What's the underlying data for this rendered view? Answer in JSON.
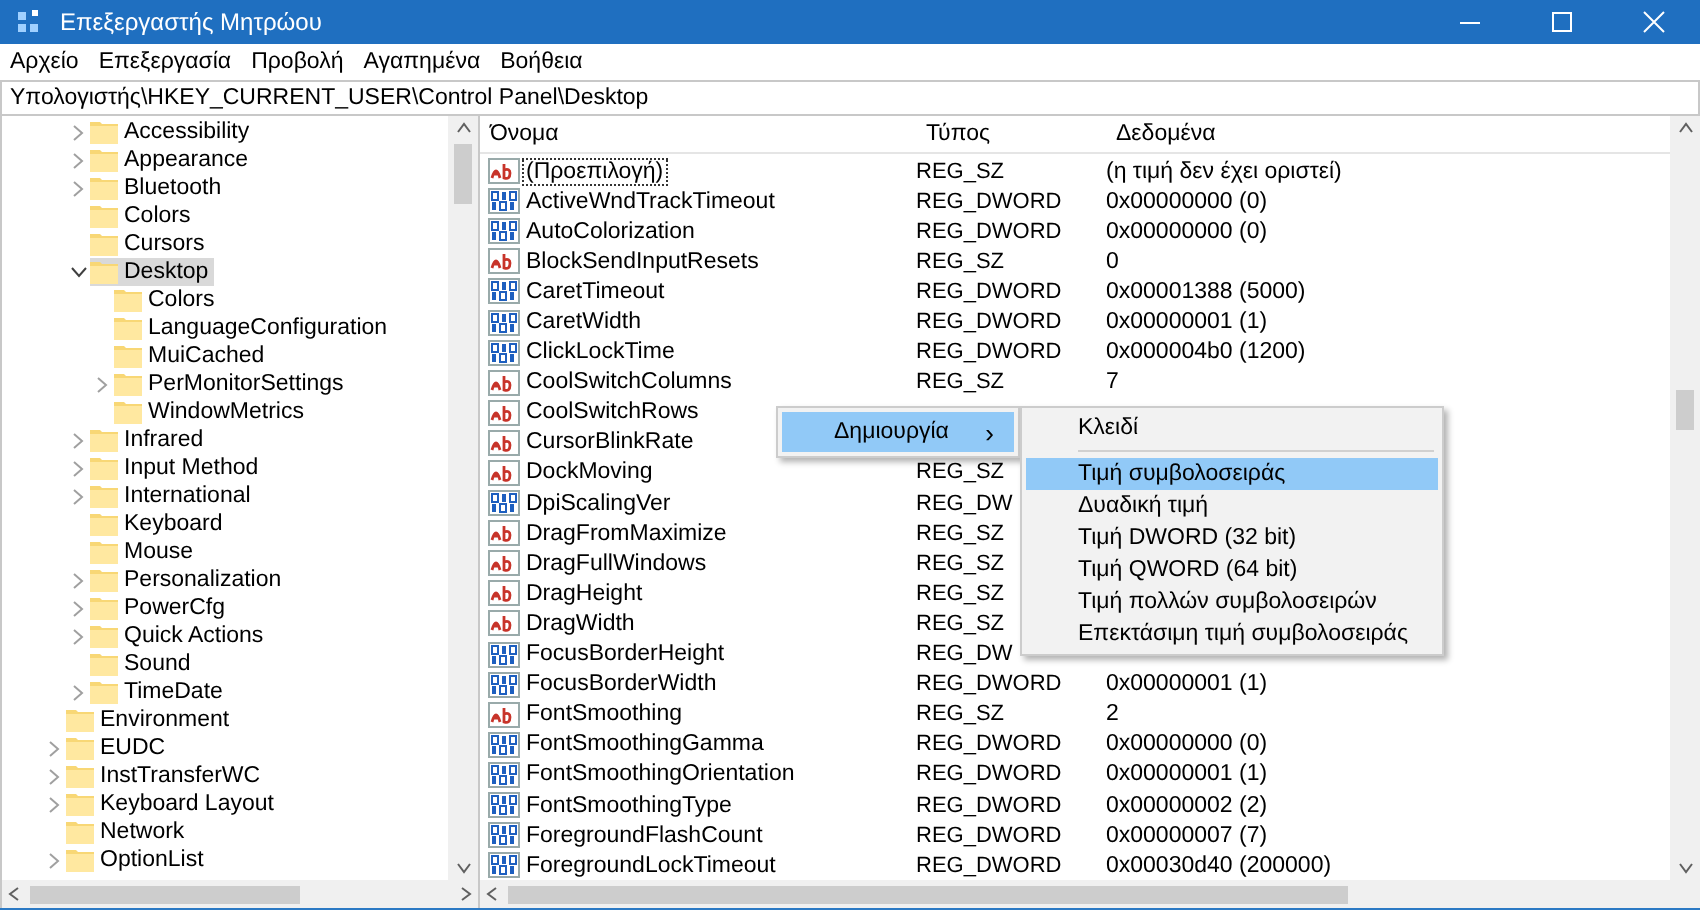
{
  "window": {
    "title": "Επεξεργαστής Μητρώου"
  },
  "menu_bar": [
    "Αρχείο",
    "Επεξεργασία",
    "Προβολή",
    "Αγαπημένα",
    "Βοήθεια"
  ],
  "address": "Υπολογιστής\\HKEY_CURRENT_USER\\Control Panel\\Desktop",
  "tree": {
    "nested_items": [
      {
        "label": "Accessibility",
        "expandable": true,
        "expanded": false,
        "selected": false
      },
      {
        "label": "Appearance",
        "expandable": true,
        "expanded": false,
        "selected": false
      },
      {
        "label": "Bluetooth",
        "expandable": true,
        "expanded": false,
        "selected": false
      },
      {
        "label": "Colors",
        "expandable": false,
        "selected": false
      },
      {
        "label": "Cursors",
        "expandable": false,
        "selected": false
      },
      {
        "label": "Desktop",
        "expandable": true,
        "expanded": true,
        "selected": true,
        "children": [
          {
            "label": "Colors",
            "expandable": false,
            "selected": false
          },
          {
            "label": "LanguageConfiguration",
            "expandable": false,
            "selected": false
          },
          {
            "label": "MuiCached",
            "expandable": false,
            "selected": false
          },
          {
            "label": "PerMonitorSettings",
            "expandable": true,
            "expanded": false,
            "selected": false
          },
          {
            "label": "WindowMetrics",
            "expandable": false,
            "selected": false
          }
        ]
      },
      {
        "label": "Infrared",
        "expandable": true,
        "expanded": false,
        "selected": false
      },
      {
        "label": "Input Method",
        "expandable": true,
        "expanded": false,
        "selected": false
      },
      {
        "label": "International",
        "expandable": true,
        "expanded": false,
        "selected": false
      },
      {
        "label": "Keyboard",
        "expandable": false,
        "selected": false
      },
      {
        "label": "Mouse",
        "expandable": false,
        "selected": false
      },
      {
        "label": "Personalization",
        "expandable": true,
        "expanded": false,
        "selected": false
      },
      {
        "label": "PowerCfg",
        "expandable": true,
        "expanded": false,
        "selected": false
      },
      {
        "label": "Quick Actions",
        "expandable": true,
        "expanded": false,
        "selected": false
      },
      {
        "label": "Sound",
        "expandable": false,
        "selected": false
      },
      {
        "label": "TimeDate",
        "expandable": true,
        "expanded": false,
        "selected": false
      }
    ],
    "items": [
      {
        "label": "Environment",
        "expandable": false,
        "selected": false
      },
      {
        "label": "EUDC",
        "expandable": true,
        "expanded": false,
        "selected": false
      },
      {
        "label": "InstTransferWC",
        "expandable": true,
        "expanded": false,
        "selected": false
      },
      {
        "label": "Keyboard Layout",
        "expandable": true,
        "expanded": false,
        "selected": false
      },
      {
        "label": "Network",
        "expandable": false,
        "selected": false
      },
      {
        "label": "OptionList",
        "expandable": true,
        "expanded": false,
        "selected": false
      }
    ]
  },
  "values": {
    "columns": [
      "Όνομα",
      "Τύπος",
      "Δεδομένα"
    ],
    "rows": [
      {
        "kind": "sz",
        "name": "(Προεπιλογή)",
        "focused": true,
        "type": "REG_SZ",
        "data": "(η τιμή δεν έχει οριστεί)"
      },
      {
        "kind": "dword",
        "name": "ActiveWndTrackTimeout",
        "focused": false,
        "type": "REG_DWORD",
        "data": "0x00000000 (0)"
      },
      {
        "kind": "dword",
        "name": "AutoColorization",
        "focused": false,
        "type": "REG_DWORD",
        "data": "0x00000000 (0)"
      },
      {
        "kind": "sz",
        "name": "BlockSendInputResets",
        "focused": false,
        "type": "REG_SZ",
        "data": "0"
      },
      {
        "kind": "dword",
        "name": "CaretTimeout",
        "focused": false,
        "type": "REG_DWORD",
        "data": "0x00001388 (5000)"
      },
      {
        "kind": "dword",
        "name": "CaretWidth",
        "focused": false,
        "type": "REG_DWORD",
        "data": "0x00000001 (1)"
      },
      {
        "kind": "dword",
        "name": "ClickLockTime",
        "focused": false,
        "type": "REG_DWORD",
        "data": "0x000004b0 (1200)"
      },
      {
        "kind": "sz",
        "name": "CoolSwitchColumns",
        "focused": false,
        "type": "REG_SZ",
        "data": "7"
      },
      {
        "kind": "sz",
        "name": "CoolSwitchRows",
        "focused": false
      },
      {
        "kind": "sz",
        "name": "CursorBlinkRate",
        "focused": false
      },
      {
        "kind": "sz",
        "name": "DockMoving",
        "focused": false,
        "type": "REG_SZ"
      },
      {
        "kind": "dword",
        "name": "DpiScalingVer",
        "focused": false,
        "type": "REG_DW"
      },
      {
        "kind": "sz",
        "name": "DragFromMaximize",
        "focused": false,
        "type": "REG_SZ"
      },
      {
        "kind": "sz",
        "name": "DragFullWindows",
        "focused": false,
        "type": "REG_SZ"
      },
      {
        "kind": "sz",
        "name": "DragHeight",
        "focused": false,
        "type": "REG_SZ"
      },
      {
        "kind": "sz",
        "name": "DragWidth",
        "focused": false,
        "type": "REG_SZ"
      },
      {
        "kind": "dword",
        "name": "FocusBorderHeight",
        "focused": false,
        "type": "REG_DW"
      },
      {
        "kind": "dword",
        "name": "FocusBorderWidth",
        "focused": false,
        "type": "REG_DWORD",
        "data": "0x00000001 (1)"
      },
      {
        "kind": "sz",
        "name": "FontSmoothing",
        "focused": false,
        "type": "REG_SZ",
        "data": "2"
      },
      {
        "kind": "dword",
        "name": "FontSmoothingGamma",
        "focused": false,
        "type": "REG_DWORD",
        "data": "0x00000000 (0)"
      },
      {
        "kind": "dword",
        "name": "FontSmoothingOrientation",
        "focused": false,
        "type": "REG_DWORD",
        "data": "0x00000001 (1)"
      },
      {
        "kind": "dword",
        "name": "FontSmoothingType",
        "focused": false,
        "type": "REG_DWORD",
        "data": "0x00000002 (2)"
      },
      {
        "kind": "dword",
        "name": "ForegroundFlashCount",
        "focused": false,
        "type": "REG_DWORD",
        "data": "0x00000007 (7)"
      },
      {
        "kind": "dword",
        "name": "ForegroundLockTimeout",
        "focused": false,
        "type": "REG_DWORD",
        "data": "0x00030d40 (200000)"
      }
    ]
  },
  "context_menu": {
    "items": [
      {
        "label": "Δημιουργία",
        "arrow": "›",
        "selected": true
      }
    ]
  },
  "submenu": {
    "items": [
      {
        "kind": "item",
        "label": "Κλειδί",
        "selected": false
      },
      {
        "kind": "separator"
      },
      {
        "kind": "item",
        "label": "Τιμή συμβολοσειράς",
        "selected": true
      },
      {
        "kind": "item",
        "label": "Δυαδική τιμή",
        "selected": false
      },
      {
        "kind": "item",
        "label": "Τιμή DWORD (32 bit)",
        "selected": false
      },
      {
        "kind": "item",
        "label": "Τιμή QWORD (64 bit)",
        "selected": false
      },
      {
        "kind": "item",
        "label": "Τιμή πολλών συμβολοσειρών",
        "selected": false
      },
      {
        "kind": "item",
        "label": "Επεκτάσιμη τιμή συμβολοσειράς",
        "selected": false
      }
    ]
  }
}
